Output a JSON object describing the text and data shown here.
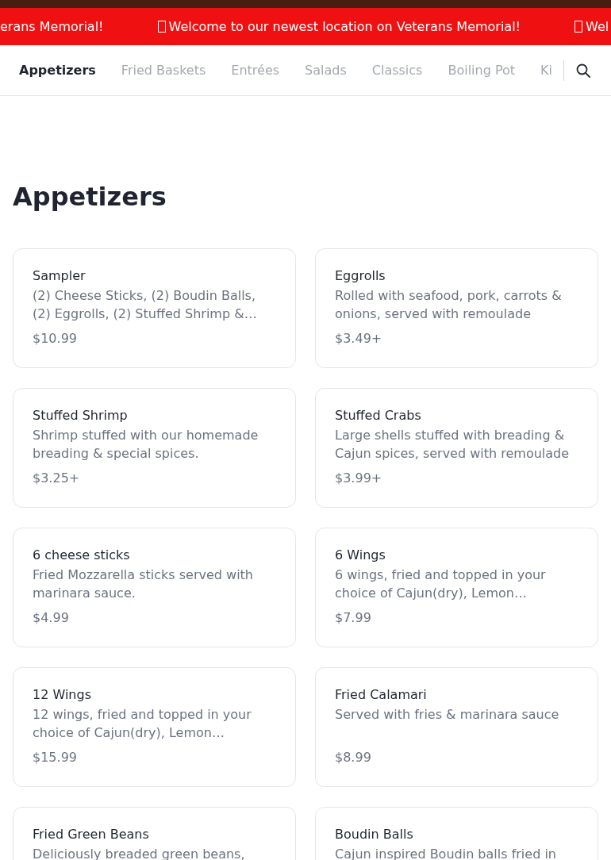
{
  "banner": {
    "items": [
      {
        "text": "erans Memorial!",
        "icon": false
      },
      {
        "text": "Welcome to our newest location on Veterans Memorial!",
        "icon": true
      },
      {
        "text": "Wel",
        "icon": true
      }
    ]
  },
  "tabs": [
    {
      "label": "Appetizers",
      "selected": true
    },
    {
      "label": "Fried Baskets",
      "selected": false
    },
    {
      "label": "Entrées",
      "selected": false
    },
    {
      "label": "Salads",
      "selected": false
    },
    {
      "label": "Classics",
      "selected": false
    },
    {
      "label": "Boiling Pot",
      "selected": false
    },
    {
      "label": "Ki",
      "selected": false
    }
  ],
  "section": {
    "title": "Appetizers"
  },
  "items": [
    {
      "name": "Sampler",
      "description": "(2) Cheese Sticks, (2) Boudin Balls, (2) Eggrolls, (2) Stuffed Shrimp &…",
      "price": "$10.99"
    },
    {
      "name": "Eggrolls",
      "description": "Rolled with seafood, pork, carrots & onions, served with remoulade",
      "price": "$3.49+"
    },
    {
      "name": "Stuffed Shrimp",
      "description": "Shrimp stuffed with our homemade breading & special spices.",
      "price": "$3.25+"
    },
    {
      "name": "Stuffed Crabs",
      "description": "Large shells stuffed with breading & Cajun spices, served with remoulade",
      "price": "$3.99+"
    },
    {
      "name": "6 cheese sticks",
      "description": "Fried Mozzarella sticks served with marinara sauce.",
      "price": "$4.99"
    },
    {
      "name": "6 Wings",
      "description": "6 wings, fried and topped in your choice of Cajun(dry), Lemon…",
      "price": "$7.99"
    },
    {
      "name": "12 Wings",
      "description": "12 wings, fried and topped in your choice of Cajun(dry), Lemon…",
      "price": "$15.99"
    },
    {
      "name": "Fried Calamari",
      "description": "Served with fries & marinara sauce",
      "price": "$8.99"
    },
    {
      "name": "Fried Green Beans",
      "description": "Deliciously breaded green beans,"
    },
    {
      "name": "Boudin Balls",
      "description": "Cajun inspired Boudin balls fried in"
    }
  ]
}
